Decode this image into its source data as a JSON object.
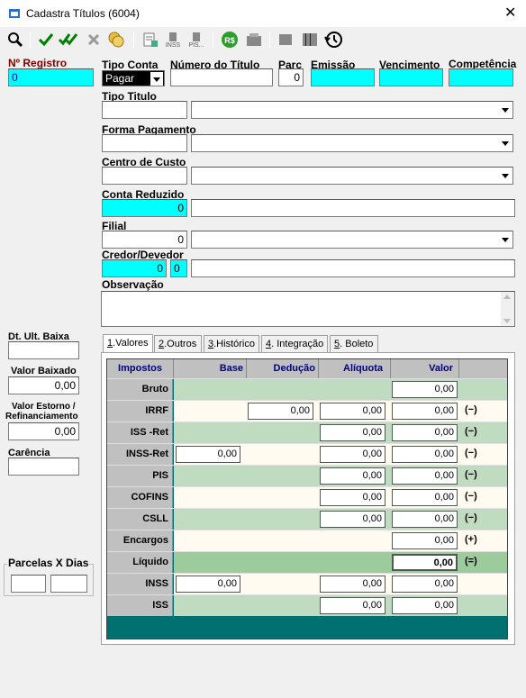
{
  "window": {
    "title": "Cadastra Títulos (6004)",
    "close_glyph": "✕"
  },
  "toolbar": {
    "icons": [
      "search-icon",
      "check-icon",
      "double-check-icon",
      "cancel-icon",
      "coins-icon",
      "calc-doc-icon",
      "inss-icon",
      "pis-icon",
      "money-icon",
      "wallet-icon",
      "doc-icon",
      "barcode-icon",
      "history-icon"
    ],
    "inss_label": "INSS",
    "pis_label": "PIS..."
  },
  "form": {
    "nregistro_label": "Nº Registro",
    "nregistro_value": "0",
    "tipo_conta_label": "Tipo Conta",
    "tipo_conta_value": "Pagar",
    "numero_titulo_label": "Número do Título",
    "numero_titulo_value": "",
    "parc_label": "Parc",
    "parc_value": "0",
    "emissao_label": "Emissão",
    "vencimento_label": "Vencimento",
    "competencia_label": "Competência",
    "tipo_titulo_label": "Tipo Titulo",
    "forma_pagamento_label": "Forma Pagamento",
    "centro_custo_label": "Centro de Custo",
    "conta_reduzido_label": "Conta Reduzido",
    "conta_reduzido_value": "0",
    "filial_label": "Filial",
    "filial_value": "0",
    "credor_label": "Credor/Devedor",
    "credor_value": "0",
    "credor_value2": "0",
    "observacao_label": "Observação"
  },
  "left": {
    "dt_ult_baixa_label": "Dt. Ult. Baixa",
    "valor_baixado_label": "Valor Baixado",
    "valor_baixado_value": "0,00",
    "valor_estorno_label_1": "Valor Estorno /",
    "valor_estorno_label_2": "Refinanciamento",
    "valor_estorno_value": "0,00",
    "carencia_label": "Carência",
    "parcelas_label": "Parcelas X Dias"
  },
  "tabs": [
    {
      "num": "1",
      "label": ".Valores"
    },
    {
      "num": "2",
      "label": ".Outros"
    },
    {
      "num": "3",
      "label": ".Histórico"
    },
    {
      "num": "4",
      "label": ". Integração"
    },
    {
      "num": "5",
      "label": ". Boleto"
    }
  ],
  "grid": {
    "headers": [
      "Impostos",
      "Base",
      "Dedução",
      "Alíquota",
      "Valor"
    ],
    "rows": [
      {
        "name": "Bruto",
        "base": null,
        "deducao": null,
        "aliquota": null,
        "valor": "0,00",
        "sign": ""
      },
      {
        "name": "IRRF",
        "base": null,
        "deducao": "0,00",
        "aliquota": "0,00",
        "valor": "0,00",
        "sign": "(−)"
      },
      {
        "name": "ISS -Ret",
        "base": null,
        "deducao": null,
        "aliquota": "0,00",
        "valor": "0,00",
        "sign": "(−)"
      },
      {
        "name": "INSS-Ret",
        "base": "0,00",
        "deducao": null,
        "aliquota": "0,00",
        "valor": "0,00",
        "sign": "(−)"
      },
      {
        "name": "PIS",
        "base": null,
        "deducao": null,
        "aliquota": "0,00",
        "valor": "0,00",
        "sign": "(−)"
      },
      {
        "name": "COFINS",
        "base": null,
        "deducao": null,
        "aliquota": "0,00",
        "valor": "0,00",
        "sign": "(−)"
      },
      {
        "name": "CSLL",
        "base": null,
        "deducao": null,
        "aliquota": "0,00",
        "valor": "0,00",
        "sign": "(−)"
      },
      {
        "name": "Encargos",
        "base": null,
        "deducao": null,
        "aliquota": null,
        "valor": "0,00",
        "sign": "(+)"
      },
      {
        "name": "Líquido",
        "base": null,
        "deducao": null,
        "aliquota": null,
        "valor": "0,00",
        "sign": "(=)"
      },
      {
        "name": "INSS",
        "base": "0,00",
        "deducao": null,
        "aliquota": "0,00",
        "valor": "0,00",
        "sign": ""
      },
      {
        "name": "ISS",
        "base": null,
        "deducao": null,
        "aliquota": "0,00",
        "valor": "0,00",
        "sign": ""
      }
    ]
  },
  "colors": {
    "cyan": "#00ffff",
    "grid_green": "#c0dcc0",
    "grid_cream": "#fffbf0",
    "grid_bg": "#007070",
    "liquido": "#9ccc9c"
  }
}
